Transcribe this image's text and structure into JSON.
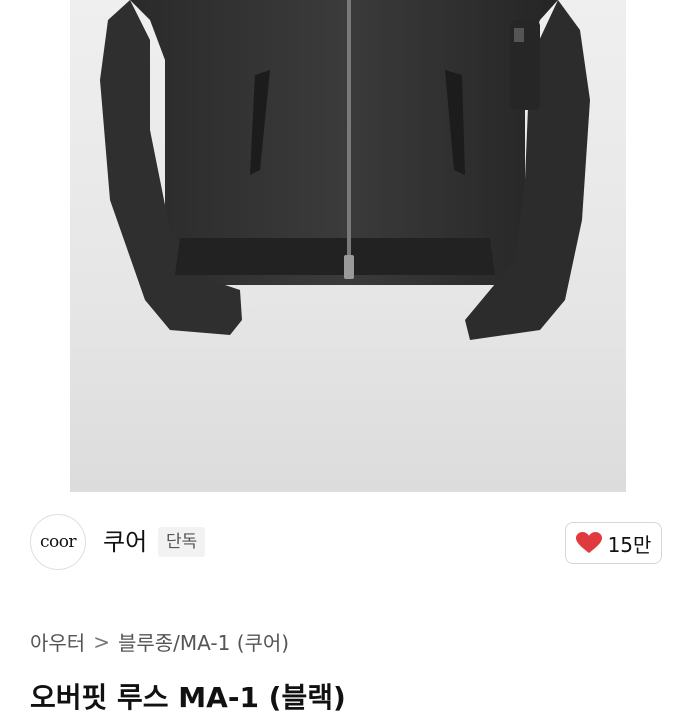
{
  "product": {
    "image_alt": "black MA-1 jacket",
    "title": "오버핏 루스 MA-1 (블랙)"
  },
  "brand": {
    "logo_text": "coor",
    "name": "쿠어",
    "badge": "단독"
  },
  "like": {
    "icon": "heart-icon",
    "count": "15만",
    "color": "#e0393e"
  },
  "breadcrumb": {
    "category": "아우터",
    "separator": ">",
    "subcategory": "블루종/MA-1 (쿠어)"
  }
}
